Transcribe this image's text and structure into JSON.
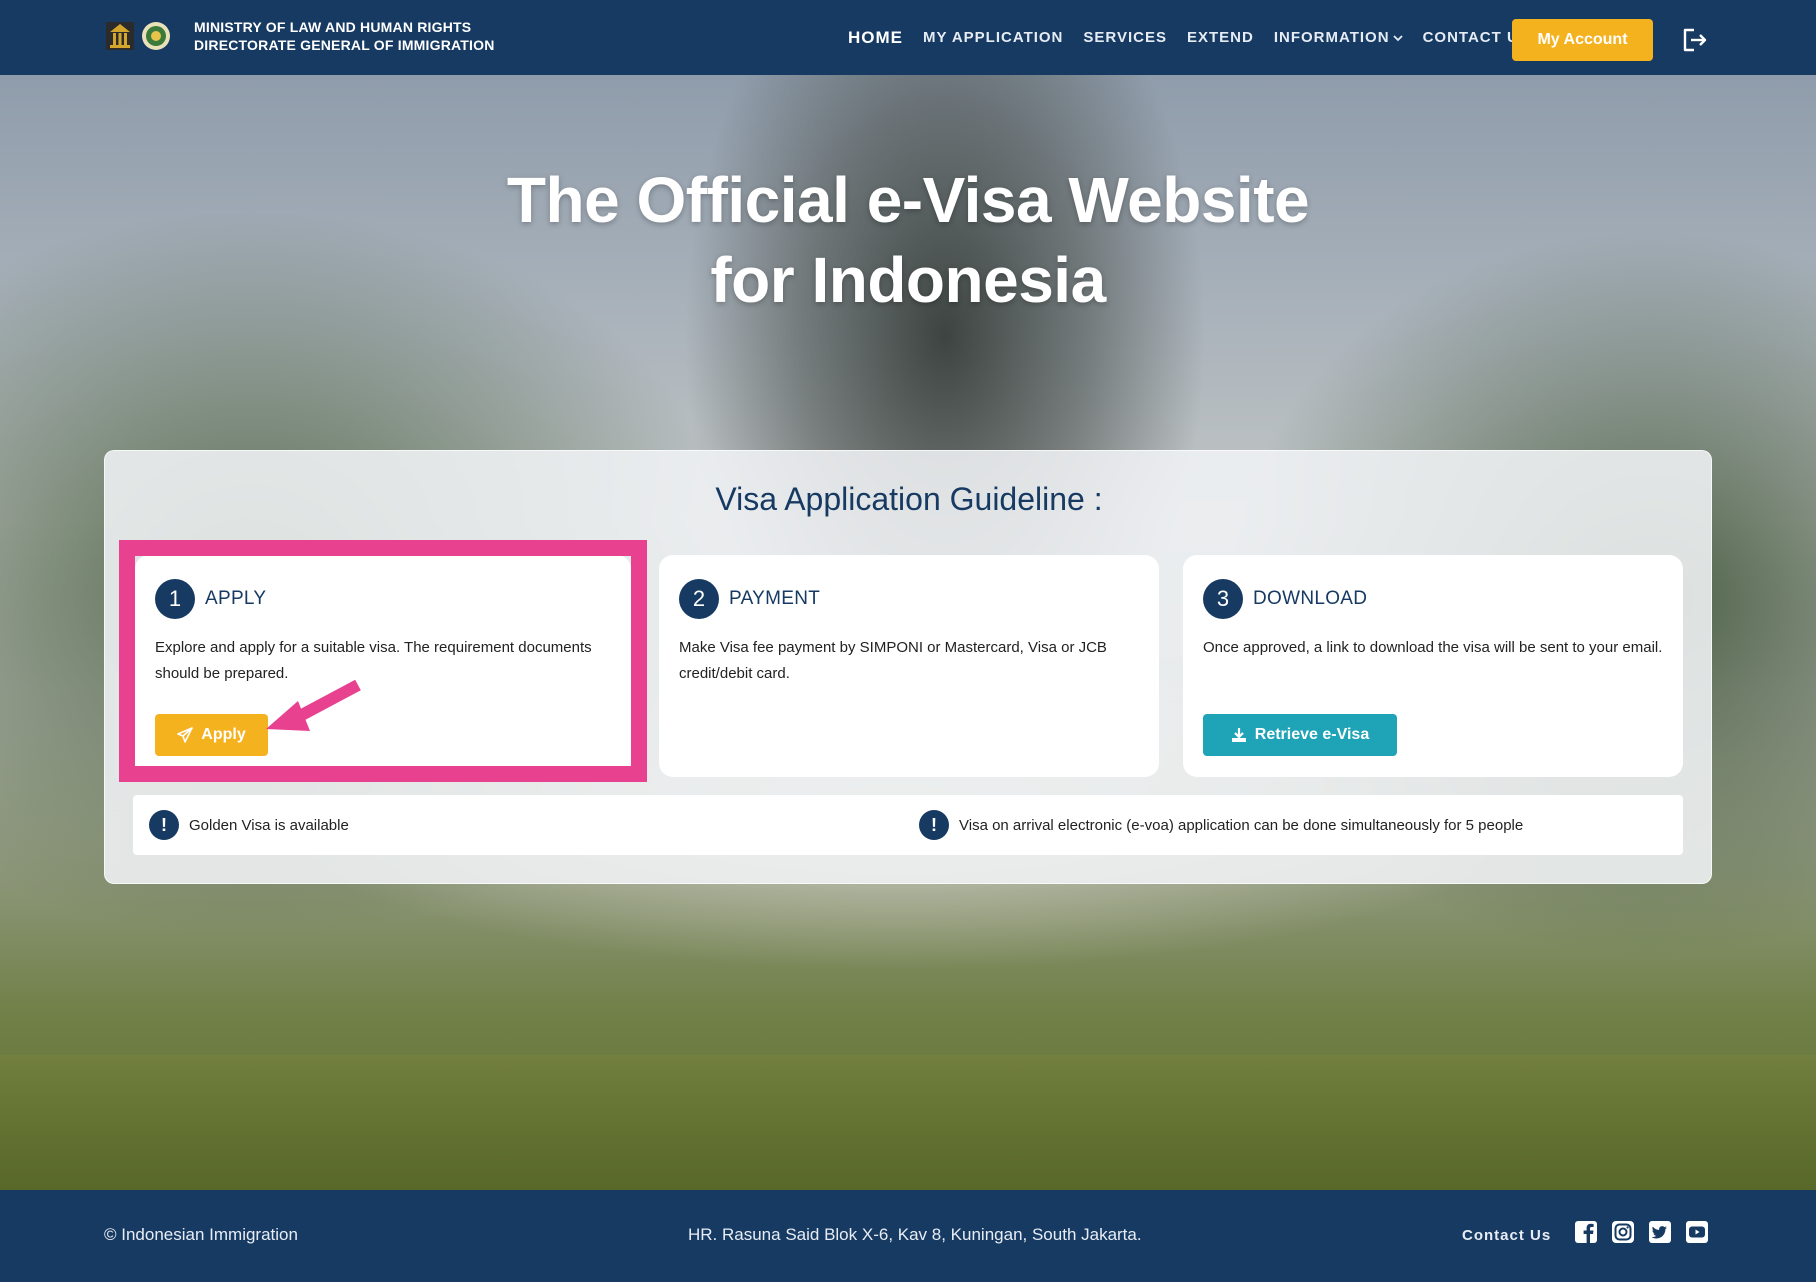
{
  "header": {
    "org_line1": "MINISTRY OF  LAW  AND HUMAN RIGHTS",
    "org_line2": "DIRECTORATE GENERAL OF IMMIGRATION",
    "nav": {
      "home": "HOME",
      "my_application": "MY APPLICATION",
      "services": "SERVICES",
      "extend": "EXTEND",
      "information": "INFORMATION",
      "contact": "CONTACT US"
    },
    "account_button": "My Account",
    "icons": {
      "logout": "logout-icon",
      "dropdown": "chevron-down-icon"
    }
  },
  "hero": {
    "title_line1": "The Official e-Visa Website",
    "title_line2": "for Indonesia"
  },
  "guideline": {
    "title": "Visa Application Guideline :",
    "steps": [
      {
        "number": "1",
        "title": "APPLY",
        "text": "Explore and apply for a suitable visa. The requirement documents should be prepared.",
        "button": "Apply",
        "button_icon": "paper-plane-icon"
      },
      {
        "number": "2",
        "title": "PAYMENT",
        "text": "Make Visa fee payment by SIMPONI or Mastercard, Visa or JCB credit/debit card."
      },
      {
        "number": "3",
        "title": "DOWNLOAD",
        "text": "Once approved, a link to download the visa will be sent to your email.",
        "button": "Retrieve e-Visa",
        "button_icon": "download-icon"
      }
    ],
    "notices": [
      {
        "icon": "!",
        "text": "Golden Visa is available"
      },
      {
        "icon": "!",
        "text": "Visa on arrival electronic (e-voa) application can be done simultaneously for 5 people"
      }
    ]
  },
  "footer": {
    "copyright": "© Indonesian Immigration",
    "address": "HR. Rasuna Said Blok X-6, Kav 8, Kuningan, South Jakarta.",
    "contact": "Contact Us",
    "social": [
      "facebook-icon",
      "instagram-icon",
      "twitter-icon",
      "youtube-icon"
    ]
  },
  "colors": {
    "navy": "#173a63",
    "accent_yellow": "#f5b21f",
    "teal": "#1fa4b7",
    "highlight_pink": "#e8418f"
  }
}
